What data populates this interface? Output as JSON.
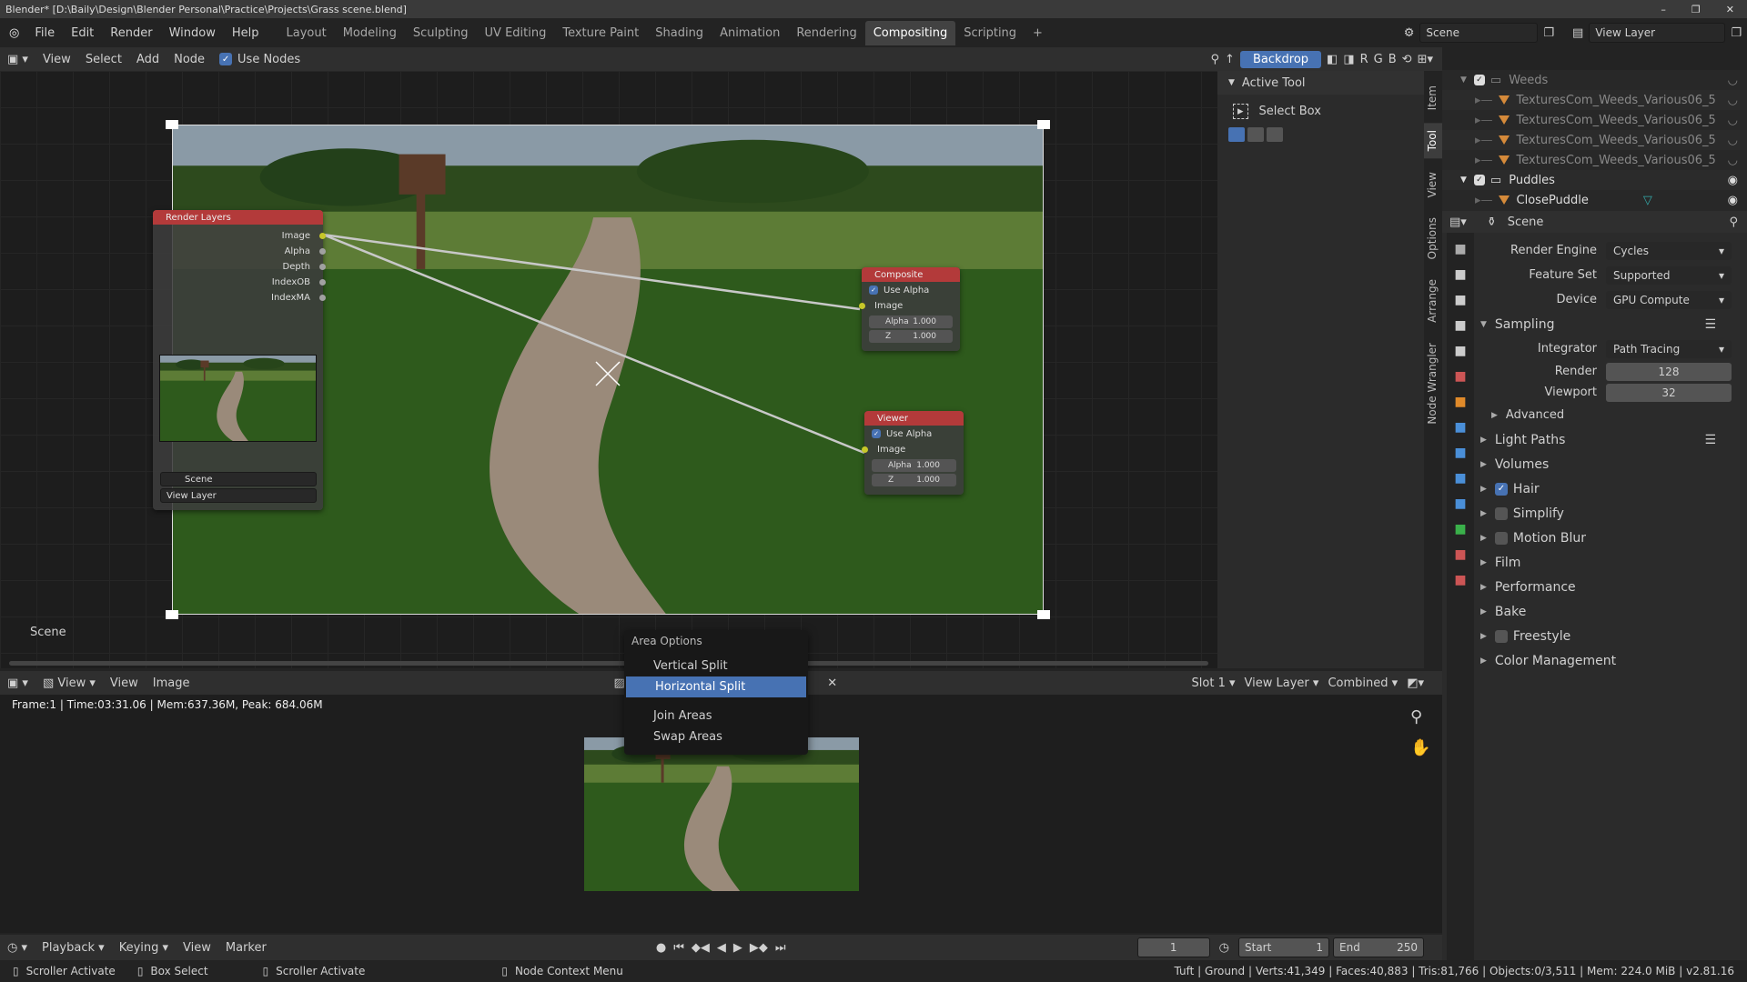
{
  "window": {
    "title": "Blender* [D:\\Baily\\Design\\Blender Personal\\Practice\\Projects\\Grass scene.blend]",
    "controls": [
      "–",
      "❐",
      "✕"
    ]
  },
  "menu": [
    "File",
    "Edit",
    "Render",
    "Window",
    "Help"
  ],
  "workspaces": [
    {
      "label": "Layout"
    },
    {
      "label": "Modeling"
    },
    {
      "label": "Sculpting"
    },
    {
      "label": "UV Editing"
    },
    {
      "label": "Texture Paint"
    },
    {
      "label": "Shading"
    },
    {
      "label": "Animation"
    },
    {
      "label": "Rendering"
    },
    {
      "label": "Compositing",
      "active": true
    },
    {
      "label": "Scripting"
    },
    {
      "label": "+"
    }
  ],
  "scene_selector": "Scene",
  "view_layer_selector": "View Layer",
  "node_header": {
    "menus": [
      "View",
      "Select",
      "Add",
      "Node"
    ],
    "use_nodes": "Use Nodes",
    "backdrop": "Backdrop",
    "channels": [
      "R",
      "G",
      "B"
    ]
  },
  "nodes": {
    "render_layers": {
      "title": "Render Layers",
      "outputs": [
        "Image",
        "Alpha",
        "Depth",
        "IndexOB",
        "IndexMA"
      ],
      "scene": "Scene",
      "view_layer": "View Layer"
    },
    "composite": {
      "title": "Composite",
      "use_alpha": "Use Alpha",
      "input": "Image",
      "alpha_label": "Alpha",
      "alpha": "1.000",
      "z_label": "Z",
      "z": "1.000"
    },
    "viewer": {
      "title": "Viewer",
      "use_alpha": "Use Alpha",
      "input": "Image",
      "alpha_label": "Alpha",
      "alpha": "1.000",
      "z_label": "Z",
      "z": "1.000"
    }
  },
  "node_tree_label": "Scene",
  "npanel": {
    "section": "Active Tool",
    "tool": "Select Box",
    "tabs": [
      "Item",
      "Tool",
      "View",
      "Options",
      "Arrange",
      "Node Wrangler"
    ]
  },
  "image_header": {
    "menus": [
      "View",
      "View",
      "Image"
    ],
    "slot": "Slot 1",
    "layer": "View Layer",
    "pass": "Combined"
  },
  "render_info": "Frame:1 | Time:03:31.06 | Mem:637.36M, Peak: 684.06M",
  "area_menu": {
    "title": "Area Options",
    "items": [
      {
        "label": "Vertical Split"
      },
      {
        "label": "Horizontal Split",
        "selected": true
      },
      {
        "label": "Join Areas"
      },
      {
        "label": "Swap Areas"
      }
    ]
  },
  "timeline": {
    "menus": [
      "Playback",
      "Keying",
      "View",
      "Marker"
    ],
    "frame": "1",
    "start_label": "Start",
    "start": "1",
    "end_label": "End",
    "end": "250"
  },
  "status": {
    "items": [
      "Scroller Activate",
      "Box Select",
      "Scroller Activate",
      "Node Context Menu"
    ],
    "stats": "Tuft | Ground | Verts:41,349 | Faces:40,883 | Tris:81,766 | Objects:0/3,511 | Mem: 224.0 MiB | v2.81.16"
  },
  "outliner": [
    {
      "label": "Weeds",
      "type": "collection",
      "indent": 0
    },
    {
      "label": "TexturesCom_Weeds_Various06_5",
      "type": "mesh",
      "indent": 1
    },
    {
      "label": "TexturesCom_Weeds_Various06_5",
      "type": "mesh",
      "indent": 1
    },
    {
      "label": "TexturesCom_Weeds_Various06_5",
      "type": "mesh",
      "indent": 1
    },
    {
      "label": "TexturesCom_Weeds_Various06_5",
      "type": "mesh",
      "indent": 1
    },
    {
      "label": "Puddles",
      "type": "collection",
      "indent": 0
    },
    {
      "label": "ClosePuddle",
      "type": "mesh",
      "indent": 1
    }
  ],
  "properties": {
    "context": "Scene",
    "render_engine_label": "Render Engine",
    "render_engine": "Cycles",
    "feature_set_label": "Feature Set",
    "feature_set": "Supported",
    "device_label": "Device",
    "device": "GPU Compute",
    "sampling": "Sampling",
    "integrator_label": "Integrator",
    "integrator": "Path Tracing",
    "render_label": "Render",
    "render": "128",
    "viewport_label": "Viewport",
    "viewport": "32",
    "advanced": "Advanced",
    "sections": [
      {
        "label": "Light Paths"
      },
      {
        "label": "Volumes"
      },
      {
        "label": "Hair",
        "check": true
      },
      {
        "label": "Simplify",
        "check": false
      },
      {
        "label": "Motion Blur",
        "check": false
      },
      {
        "label": "Film"
      },
      {
        "label": "Performance"
      },
      {
        "label": "Bake"
      },
      {
        "label": "Freestyle",
        "check": false
      },
      {
        "label": "Color Management"
      }
    ]
  },
  "colors": {
    "accent": "#4772b3",
    "node_header": "#b33a3a",
    "socket_image": "#c7c729"
  }
}
